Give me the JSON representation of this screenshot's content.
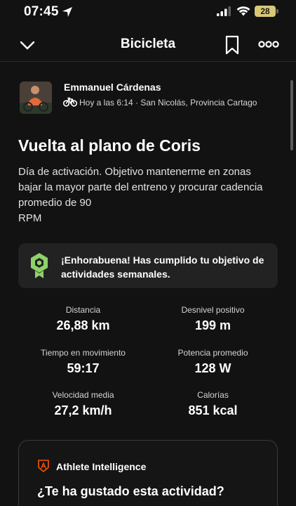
{
  "status_bar": {
    "time": "07:45",
    "battery": "28"
  },
  "nav": {
    "title": "Bicicleta"
  },
  "athlete": {
    "name": "Emmanuel Cárdenas",
    "meta": "Hoy a las 6:14 · San Nicolás, Provincia Cartago"
  },
  "activity": {
    "title": "Vuelta al plano de Coris",
    "description_lines": [
      "Día de activación. Objetivo mantenerme en zonas",
      "bajar la mayor parte del entreno y procurar cadencia",
      "promedio de 90",
      "RPM"
    ]
  },
  "goal": {
    "line1": "¡Enhorabuena! Has cumplido tu objetivo de",
    "line2": "actividades semanales."
  },
  "stats": [
    {
      "label": "Distancia",
      "value": "26,88 km"
    },
    {
      "label": "Desnivel positivo",
      "value": "199 m"
    },
    {
      "label": "Tiempo en movimiento",
      "value": "59:17"
    },
    {
      "label": "Potencia promedio",
      "value": "128 W"
    },
    {
      "label": "Velocidad media",
      "value": "27,2 km/h"
    },
    {
      "label": "Calorías",
      "value": "851 kcal"
    }
  ],
  "athlete_intelligence": {
    "title": "Athlete Intelligence",
    "question": "¿Te ha gustado esta actividad?"
  },
  "colors": {
    "background": "#121212",
    "card": "#222222",
    "badge_green": "#8fd16a",
    "strava_orange": "#fc5200",
    "battery": "#d8c875"
  },
  "icons": [
    "location-arrow-icon",
    "signal-icon",
    "wifi-icon",
    "battery-icon",
    "chevron-down-icon",
    "bookmark-icon",
    "more-icon",
    "bike-icon",
    "badge-icon",
    "athlete-intelligence-icon"
  ]
}
